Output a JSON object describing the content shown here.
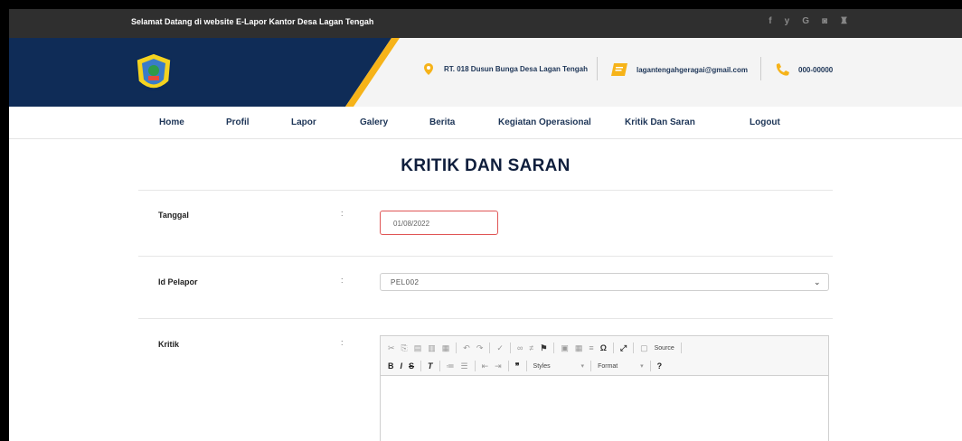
{
  "topbar": {
    "welcome": "Selamat Datang di website E-Lapor Kantor Desa Lagan Tengah",
    "social_icons": [
      "facebook-icon",
      "twitter-icon",
      "google-icon",
      "instagram-icon",
      "youtube-icon"
    ],
    "social_glyphs": [
      "f",
      "y",
      "G",
      "◙",
      "♜"
    ]
  },
  "header": {
    "address": "RT. 018 Dusun Bunga Desa Lagan Tengah",
    "email": "lagantengahgeragai@gmail.com",
    "phone": "000-00000",
    "colors": {
      "navy": "#0f2c57",
      "accent": "#f6b319"
    }
  },
  "nav": {
    "items": [
      "Home",
      "Profil",
      "Lapor",
      "Galery",
      "Berita",
      "Kegiatan Operasional",
      "Kritik Dan Saran",
      "Logout"
    ]
  },
  "main": {
    "title": "KRITIK DAN SARAN",
    "fields": {
      "tanggal_label": "Tanggal",
      "tanggal_value": "01/08/2022",
      "id_pelapor_label": "Id Pelapor",
      "id_pelapor_value": "PEL002",
      "kritik_label": "Kritik",
      "colon": ":"
    },
    "editor": {
      "source_label": "Source",
      "styles_label": "Styles",
      "format_label": "Format"
    }
  }
}
